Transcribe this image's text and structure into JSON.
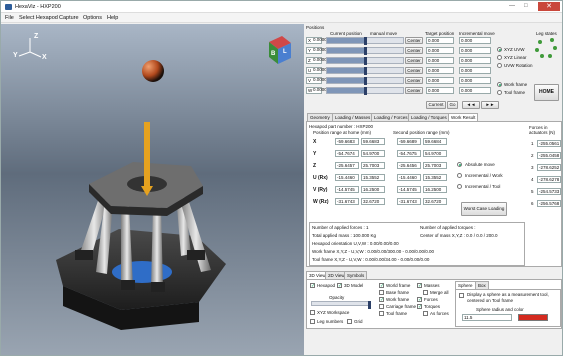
{
  "window": {
    "title": "HexaViz - HXP200",
    "minimize": "—",
    "maximize": "□",
    "close": "✕"
  },
  "menu": [
    "File",
    "Select Hexapod",
    "Capture",
    "Options",
    "Help"
  ],
  "scene": {
    "axis_z": "Z",
    "axis_y": "Y",
    "axis_x": "X",
    "cube_labels": [
      "B",
      "L"
    ]
  },
  "positions": {
    "title": "Positions",
    "headers": {
      "current": "Current position",
      "manual": "manual move",
      "target": "Target position",
      "incremental": "Incremental move"
    },
    "rows": [
      {
        "label": "X",
        "current": "0.0000",
        "center": "Center",
        "target": "0.000",
        "incr": "0.000",
        "fill": 0.5
      },
      {
        "label": "Y",
        "current": "0.0000",
        "center": "Center",
        "target": "0.000",
        "incr": "0.000",
        "fill": 0.5
      },
      {
        "label": "Z",
        "current": "0.0000",
        "center": "Center",
        "target": "0.000",
        "incr": "0.000",
        "fill": 0.5
      },
      {
        "label": "U",
        "current": "0.0000",
        "center": "Center",
        "target": "0.000",
        "incr": "0.000",
        "fill": 0.5
      },
      {
        "label": "V",
        "current": "0.0000",
        "center": "Center",
        "target": "0.000",
        "incr": "0.000",
        "fill": 0.5
      },
      {
        "label": "W",
        "current": "0.0000",
        "center": "Center",
        "target": "0.000",
        "incr": "0.000",
        "fill": 0.5
      }
    ],
    "current_btn": "Current",
    "go_btn": "Go",
    "step_back": "◄◄",
    "step_fwd": "►►",
    "modes": [
      "XYZ UVW",
      "XYZ Linear",
      "UVW Rotation"
    ],
    "frames": [
      "Work frame",
      "Tool frame"
    ],
    "leg_states": "Leg states",
    "home": "HOME"
  },
  "tabs": [
    "Geometry",
    "Loading / Masses",
    "Loading / Forces",
    "Loading / Torques",
    "Work Result"
  ],
  "result": {
    "part_number": "Hexapod part number : HXP200",
    "range_title": "Position range at home (mm)",
    "range_title2": "Second position range (mm)",
    "forces_title": "Forces in actuators (N)",
    "rows": [
      {
        "axis": "X",
        "a": "-59.6683",
        "b": "59.6683",
        "c": "-59.6689",
        "d": "59.6684"
      },
      {
        "axis": "Y",
        "a": "-54.7674",
        "b": "54.9700",
        "c": "-54.7675",
        "d": "54.9700"
      },
      {
        "axis": "Z",
        "a": "-25.6457",
        "b": "25.7003",
        "c": "-25.6456",
        "d": "25.7003"
      },
      {
        "axis": "U (Rx)",
        "a": "-15.4460",
        "b": "15.3552",
        "c": "-15.4460",
        "d": "15.3552"
      },
      {
        "axis": "V (Ry)",
        "a": "-14.5745",
        "b": "16.2500",
        "c": "-14.5745",
        "d": "16.2500"
      },
      {
        "axis": "W (Rz)",
        "a": "-31.6743",
        "b": "32.6720",
        "c": "-31.6743",
        "d": "32.6720"
      }
    ],
    "forces": [
      {
        "i": "1",
        "v": "-255.0561"
      },
      {
        "i": "2",
        "v": "-255.0458"
      },
      {
        "i": "3",
        "v": "-278.6252"
      },
      {
        "i": "4",
        "v": "-278.6278"
      },
      {
        "i": "5",
        "v": "-254.5733"
      },
      {
        "i": "6",
        "v": "-256.5768"
      }
    ],
    "motion": [
      "Absolute move",
      "Incremental / Work",
      "Incremental / Tool"
    ],
    "worst_case": "Worst Case Loading",
    "summary": [
      "Number of applied forces : 1",
      "Number of applied torques :",
      "Total applied mass : 100.000 Kg",
      "Center of mass X,Y,Z : 0.0 / 0.0 / 200.0",
      "Hexapod orientation U,V,W : 0.00/0.00/0.00",
      "Work frame X,Y,Z - U,V,W : 0.00/0.00/300.00 - 0.00/0.00/0.00",
      "Tool frame X,Y,Z - U,V,W : 0.00/0.00/34.00 - 0.00/0.00/0.00"
    ]
  },
  "bottom_tabs": [
    "3D View",
    "2D View",
    "Symbols"
  ],
  "view3d": {
    "col1": [
      {
        "t": "Hexapod",
        "c": true
      },
      {
        "t": "3D Model",
        "c": true
      }
    ],
    "opacity": "Opacity",
    "col1b": [
      {
        "t": "XYZ Workspace",
        "c": false
      },
      {
        "t": "Leg numbers",
        "c": false
      },
      {
        "t": "Grid",
        "c": false
      }
    ],
    "col2": [
      {
        "t": "World frame",
        "c": true
      },
      {
        "t": "Base frame",
        "c": false
      },
      {
        "t": "Work frame",
        "c": true
      },
      {
        "t": "Carriage frame",
        "c": false
      },
      {
        "t": "Tool frame",
        "c": false
      }
    ],
    "col3": [
      {
        "t": "Masses",
        "c": true
      },
      {
        "t": "Merge all",
        "c": false
      },
      {
        "t": "Forces",
        "c": true
      },
      {
        "t": "Torques",
        "c": true
      },
      {
        "t": "As forces",
        "c": false
      }
    ],
    "sphere_tabs": [
      "Sphere",
      "Box"
    ],
    "sphere_label": "Display a sphere as a measurement tool, centered on Tool frame",
    "sphere_radius": "Sphere radius and color",
    "radius_value": "11.5",
    "sphere_color": "#d42a1f"
  }
}
